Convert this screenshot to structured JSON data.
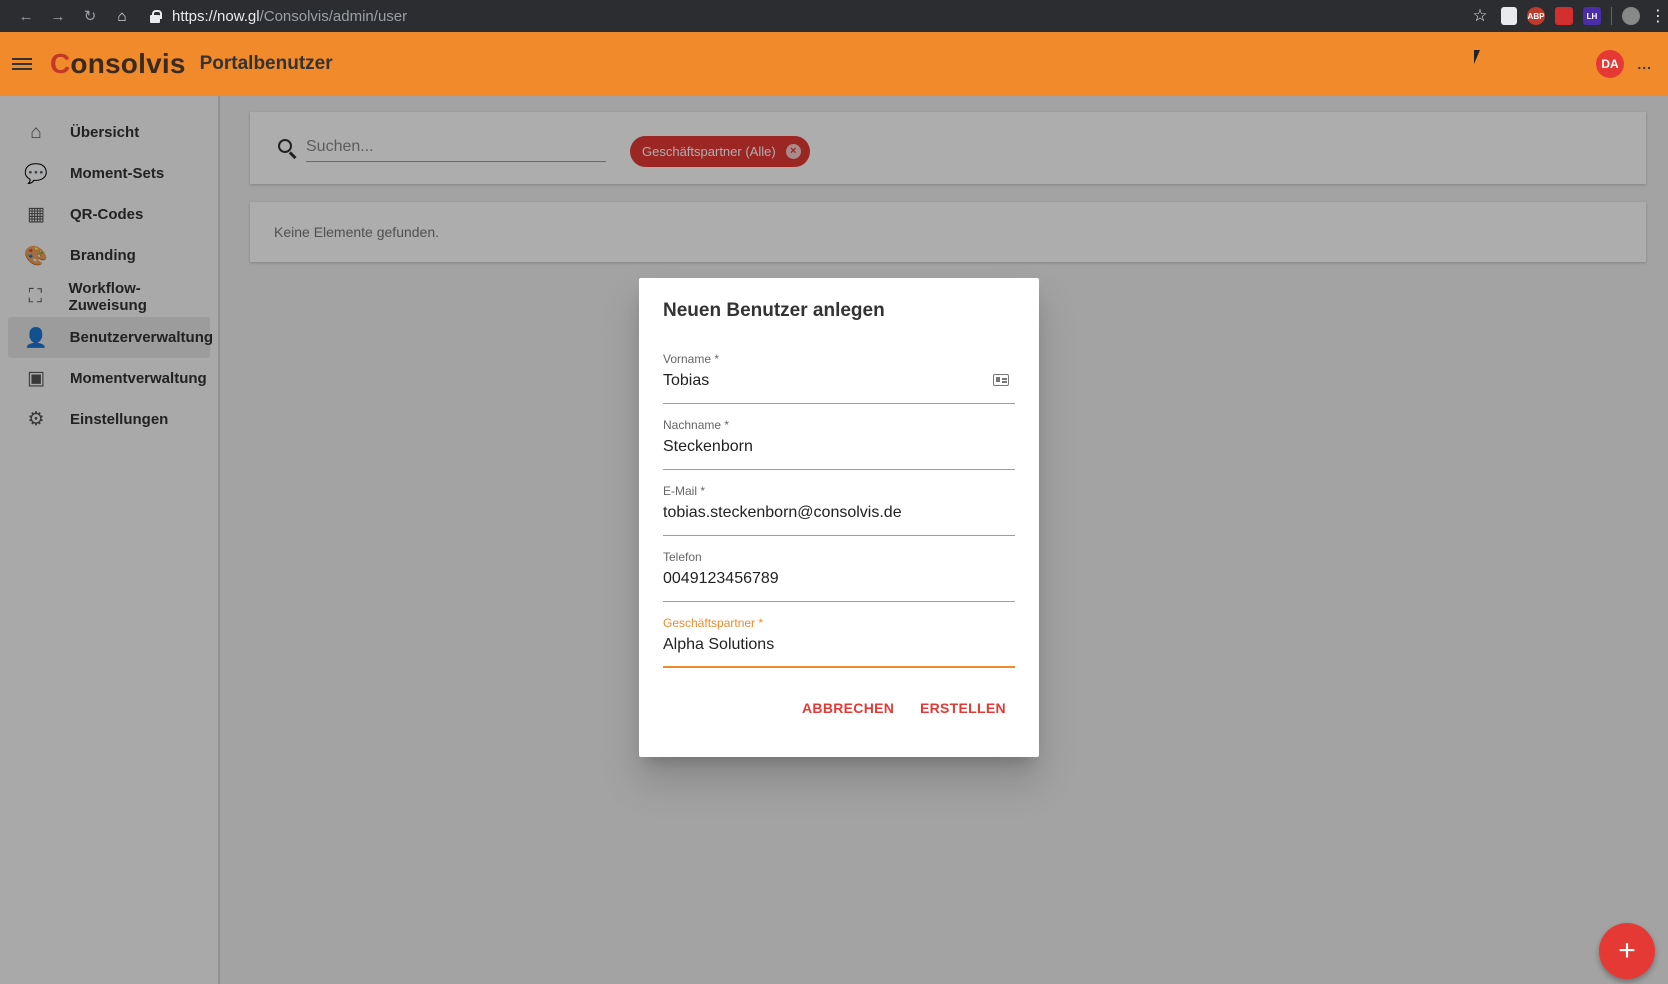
{
  "browser": {
    "nav": {
      "back": "←",
      "forward": "→",
      "reload": "↻",
      "home": "⌂"
    },
    "url_host": "https://now.gl",
    "url_path": "/Consolvis/admin/user",
    "extensions": [
      "ABP",
      "LH"
    ]
  },
  "header": {
    "logo_first": "C",
    "logo_rest": "onsolvis",
    "title": "Portalbenutzer",
    "avatar_initials": "DA",
    "more": "..."
  },
  "sidebar": {
    "items": [
      {
        "label": "Übersicht",
        "icon": "home-icon",
        "glyph": "⌂"
      },
      {
        "label": "Moment-Sets",
        "icon": "chat-icon",
        "glyph": "💬"
      },
      {
        "label": "QR-Codes",
        "icon": "qr-code-icon",
        "glyph": "▦"
      },
      {
        "label": "Branding",
        "icon": "palette-icon",
        "glyph": "🎨"
      },
      {
        "label": "Workflow-Zuweisung",
        "icon": "workflow-icon",
        "glyph": "⛶"
      },
      {
        "label": "Benutzerverwaltung",
        "icon": "user-icon",
        "glyph": "👤"
      },
      {
        "label": "Momentverwaltung",
        "icon": "moments-icon",
        "glyph": "▣"
      },
      {
        "label": "Einstellungen",
        "icon": "gear-icon",
        "glyph": "⚙"
      }
    ],
    "active_index": 5
  },
  "search": {
    "placeholder": "Suchen...",
    "value": ""
  },
  "filter_chip": {
    "label": "Geschäftspartner (Alle)",
    "remove": "×"
  },
  "empty_message": "Keine Elemente gefunden.",
  "dialog": {
    "title": "Neuen Benutzer anlegen",
    "fields": [
      {
        "label": "Vorname *",
        "value": "Tobias"
      },
      {
        "label": "Nachname *",
        "value": "Steckenborn"
      },
      {
        "label": "E-Mail *",
        "value": "tobias.steckenborn@consolvis.de"
      },
      {
        "label": "Telefon",
        "value": "0049123456789"
      },
      {
        "label": "Geschäftspartner *",
        "value": "Alpha Solutions"
      }
    ],
    "cancel": "ABBRECHEN",
    "create": "ERSTELLEN"
  },
  "fab_label": "+",
  "colors": {
    "accent": "#e53935",
    "appbar": "#f08a2b"
  }
}
